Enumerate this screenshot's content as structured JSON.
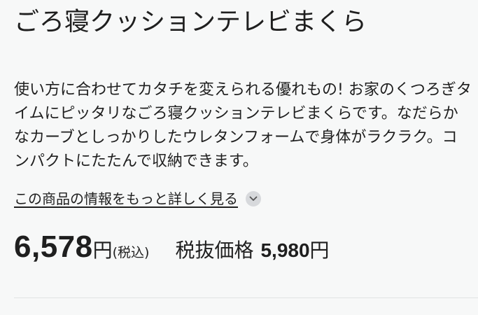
{
  "product": {
    "title": "ごろ寝クッションテレビまくら"
  },
  "description": {
    "lines": [
      "使い方に合わせてカタチを変えられる優れもの! お家のくつろぎタ",
      "イムにピッタリなごろ寝クッションテレビまくらです。なだらか",
      "なカーブとしっかりしたウレタンフォームで身体がラクラク。コ",
      "ンパクトにたたんで収納できます。"
    ]
  },
  "more_info": {
    "label": "この商品の情報をもっと詳しく見る",
    "icon": "chevron-down-icon"
  },
  "price": {
    "amount": "6,578",
    "currency": "円",
    "tax_note": "(税込)",
    "tax_excluded_label": "税抜価格",
    "tax_excluded_amount": "5,980",
    "tax_excluded_currency": "円"
  },
  "colors": {
    "background": "#f7f8f8",
    "text": "#1f1f1f",
    "icon_bg": "#d7d9dc",
    "divider": "#e1e3e4"
  }
}
